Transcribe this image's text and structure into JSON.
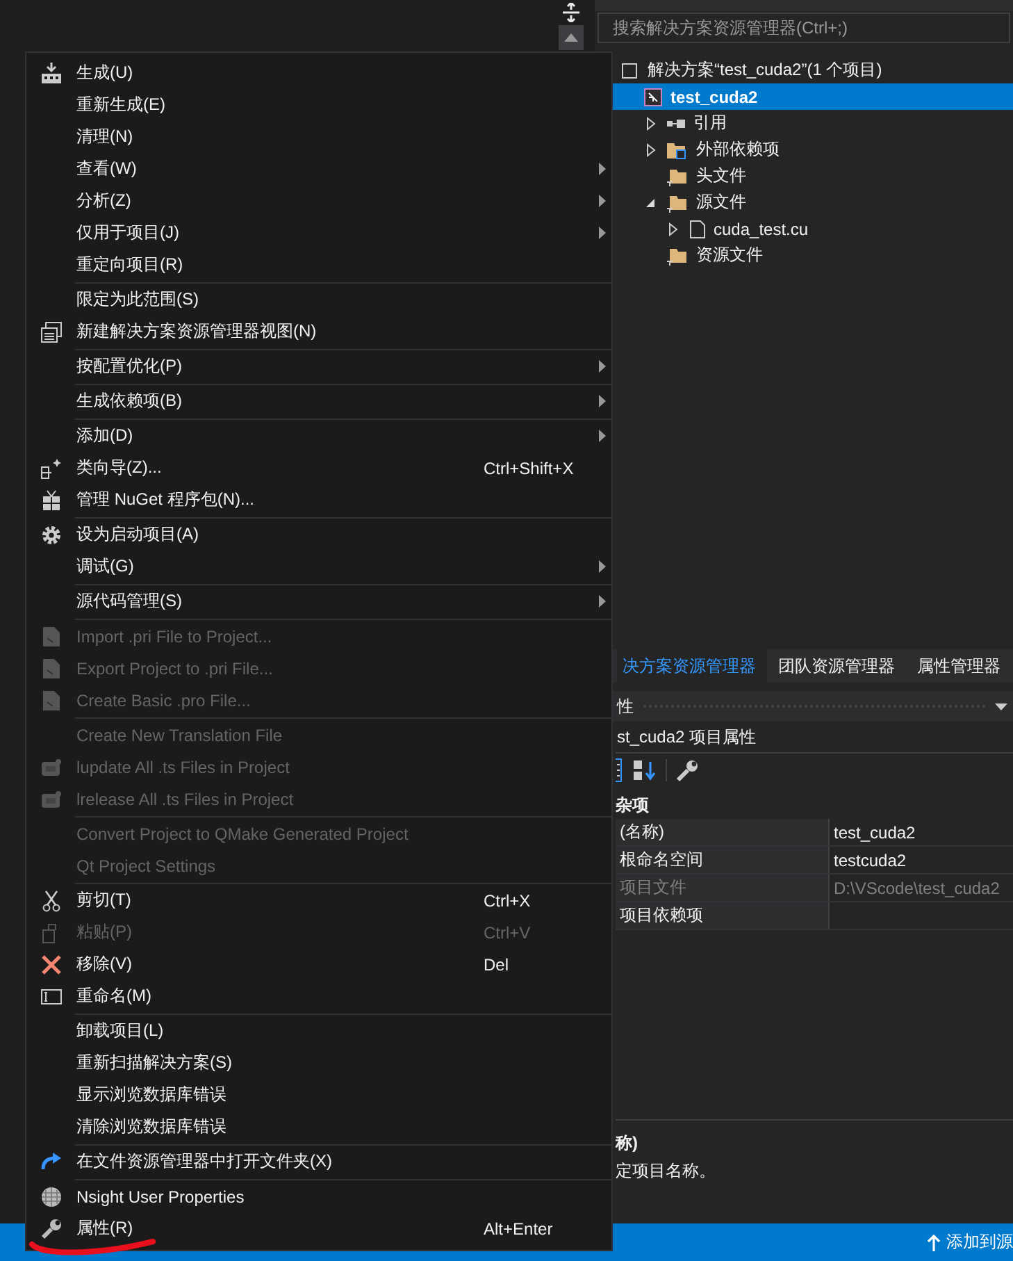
{
  "solution_explorer": {
    "search": {
      "placeholder": "搜索解决方案资源管理器(Ctrl+;)"
    },
    "tree": [
      {
        "label": "解决方案“test_cuda2”(1 个项目)",
        "kind": "solution",
        "selected": false,
        "children": [
          {
            "label": "test_cuda2",
            "kind": "project",
            "selected": true,
            "children": [
              {
                "label": "引用",
                "kind": "references",
                "selected": false,
                "expanded": false
              },
              {
                "label": "外部依赖项",
                "kind": "external",
                "selected": false,
                "expanded": false
              },
              {
                "label": "头文件",
                "kind": "filter",
                "selected": false
              },
              {
                "label": "源文件",
                "kind": "filter",
                "selected": false,
                "expanded": true,
                "children": [
                  {
                    "label": "cuda_test.cu",
                    "kind": "file",
                    "selected": false,
                    "expanded": false
                  }
                ]
              },
              {
                "label": "资源文件",
                "kind": "filter",
                "selected": false
              }
            ]
          }
        ]
      }
    ]
  },
  "tabs": [
    {
      "label": "决方案资源管理器",
      "selected": true
    },
    {
      "label": "团队资源管理器",
      "selected": false
    },
    {
      "label": "属性管理器",
      "selected": false
    }
  ],
  "properties": {
    "header": "性",
    "title": "st_cuda2 项目属性",
    "category": "杂项",
    "rows": [
      {
        "name": "(名称)",
        "value": "test_cuda2",
        "disabled": false
      },
      {
        "name": "根命名空间",
        "value": "testcuda2",
        "disabled": false
      },
      {
        "name": "项目文件",
        "value": "D:\\VScode\\test_cuda2",
        "disabled": true
      },
      {
        "name": "项目依赖项",
        "disabled": false
      }
    ],
    "description_title": "称)",
    "description": "定项目名称。"
  },
  "context_menu": [
    {
      "kind": "item",
      "label": "生成(U)",
      "submenu": false,
      "disabled": false
    },
    {
      "kind": "item",
      "label": "重新生成(E)",
      "submenu": false,
      "disabled": false
    },
    {
      "kind": "item",
      "label": "清理(N)",
      "submenu": false,
      "disabled": false
    },
    {
      "kind": "item",
      "label": "查看(W)",
      "submenu": true,
      "disabled": false
    },
    {
      "kind": "item",
      "label": "分析(Z)",
      "submenu": true,
      "disabled": false
    },
    {
      "kind": "item",
      "label": "仅用于项目(J)",
      "submenu": true,
      "disabled": false
    },
    {
      "kind": "item",
      "label": "重定向项目(R)",
      "submenu": false,
      "disabled": false
    },
    {
      "kind": "separator"
    },
    {
      "kind": "item",
      "label": "限定为此范围(S)",
      "submenu": false,
      "disabled": false
    },
    {
      "kind": "item",
      "label": "新建解决方案资源管理器视图(N)",
      "submenu": false,
      "disabled": false
    },
    {
      "kind": "separator"
    },
    {
      "kind": "item",
      "label": "按配置优化(P)",
      "submenu": true,
      "disabled": false
    },
    {
      "kind": "separator"
    },
    {
      "kind": "item",
      "label": "生成依赖项(B)",
      "submenu": true,
      "disabled": false
    },
    {
      "kind": "separator"
    },
    {
      "kind": "item",
      "label": "添加(D)",
      "submenu": true,
      "disabled": false
    },
    {
      "kind": "item",
      "label": "类向导(Z)...",
      "shortcut": "Ctrl+Shift+X",
      "submenu": false,
      "disabled": false
    },
    {
      "kind": "item",
      "label": "管理 NuGet 程序包(N)...",
      "submenu": false,
      "disabled": false
    },
    {
      "kind": "separator"
    },
    {
      "kind": "item",
      "label": "设为启动项目(A)",
      "submenu": false,
      "disabled": false
    },
    {
      "kind": "item",
      "label": "调试(G)",
      "submenu": true,
      "disabled": false
    },
    {
      "kind": "separator"
    },
    {
      "kind": "item",
      "label": "源代码管理(S)",
      "submenu": true,
      "disabled": false
    },
    {
      "kind": "separator"
    },
    {
      "kind": "item",
      "label": "Import .pri File to Project...",
      "submenu": false,
      "disabled": true
    },
    {
      "kind": "item",
      "label": "Export Project to .pri File...",
      "submenu": false,
      "disabled": true
    },
    {
      "kind": "item",
      "label": "Create Basic .pro File...",
      "submenu": false,
      "disabled": true
    },
    {
      "kind": "separator"
    },
    {
      "kind": "item",
      "label": "Create New Translation File",
      "submenu": false,
      "disabled": true
    },
    {
      "kind": "item",
      "label": "lupdate All .ts Files in Project",
      "submenu": false,
      "disabled": true
    },
    {
      "kind": "item",
      "label": "lrelease All .ts Files in Project",
      "submenu": false,
      "disabled": true
    },
    {
      "kind": "separator"
    },
    {
      "kind": "item",
      "label": "Convert Project to QMake Generated Project",
      "submenu": false,
      "disabled": true
    },
    {
      "kind": "item",
      "label": "Qt Project Settings",
      "submenu": false,
      "disabled": true
    },
    {
      "kind": "separator"
    },
    {
      "kind": "item",
      "label": "剪切(T)",
      "shortcut": "Ctrl+X",
      "submenu": false,
      "disabled": false
    },
    {
      "kind": "item",
      "label": "粘贴(P)",
      "shortcut": "Ctrl+V",
      "submenu": false,
      "disabled": true
    },
    {
      "kind": "item",
      "label": "移除(V)",
      "shortcut": "Del",
      "submenu": false,
      "disabled": false
    },
    {
      "kind": "item",
      "label": "重命名(M)",
      "submenu": false,
      "disabled": false
    },
    {
      "kind": "separator"
    },
    {
      "kind": "item",
      "label": "卸载项目(L)",
      "submenu": false,
      "disabled": false
    },
    {
      "kind": "item",
      "label": "重新扫描解决方案(S)",
      "submenu": false,
      "disabled": false
    },
    {
      "kind": "item",
      "label": "显示浏览数据库错误",
      "submenu": false,
      "disabled": false
    },
    {
      "kind": "item",
      "label": "清除浏览数据库错误",
      "submenu": false,
      "disabled": false
    },
    {
      "kind": "separator"
    },
    {
      "kind": "item",
      "label": "在文件资源管理器中打开文件夹(X)",
      "submenu": false,
      "disabled": false
    },
    {
      "kind": "separator"
    },
    {
      "kind": "item",
      "label": "Nsight User Properties",
      "submenu": false,
      "disabled": false
    },
    {
      "kind": "item",
      "label": "属性(R)",
      "shortcut": "Alt+Enter",
      "submenu": false,
      "disabled": false
    }
  ],
  "status_bar": {
    "text": "添加到源"
  }
}
